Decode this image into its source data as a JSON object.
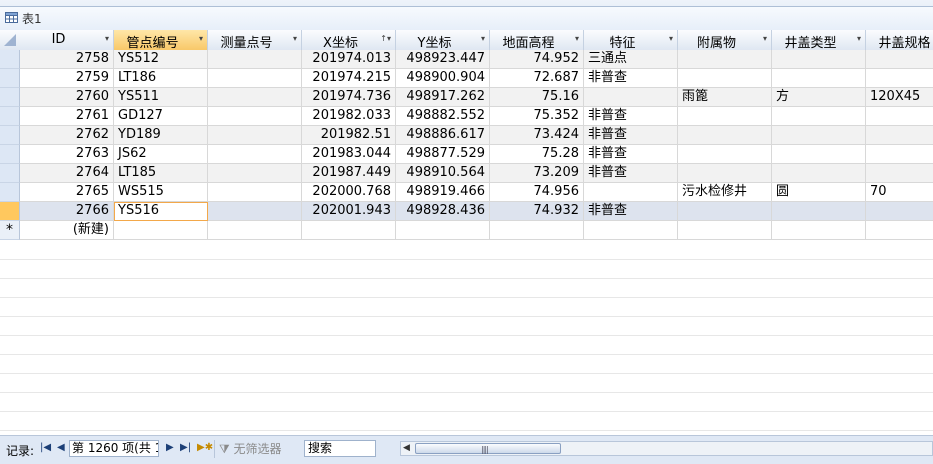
{
  "tab": {
    "label": "表1"
  },
  "columns": [
    {
      "label": "ID",
      "sorted": false,
      "icon": "dropdown-arrow"
    },
    {
      "label": "管点编号",
      "sorted": false,
      "icon": "dropdown-arrow"
    },
    {
      "label": "测量点号",
      "sorted": false,
      "icon": "dropdown-arrow"
    },
    {
      "label": "X坐标",
      "sorted": true,
      "icon": "sort-dropdown"
    },
    {
      "label": "Y坐标",
      "sorted": false,
      "icon": "dropdown-arrow"
    },
    {
      "label": "地面高程",
      "sorted": false,
      "icon": "dropdown-arrow"
    },
    {
      "label": "特征",
      "sorted": false,
      "icon": "dropdown-arrow"
    },
    {
      "label": "附属物",
      "sorted": false,
      "icon": "dropdown-arrow"
    },
    {
      "label": "井盖类型",
      "sorted": false,
      "icon": "dropdown-arrow"
    },
    {
      "label": "井盖规格",
      "sorted": false,
      "icon": "dropdown-arrow"
    }
  ],
  "rows": [
    [
      "2758",
      "YS512",
      "",
      "201974.013",
      "498923.447",
      "74.952",
      "三通点",
      "",
      "",
      ""
    ],
    [
      "2759",
      "LT186",
      "",
      "201974.215",
      "498900.904",
      "72.687",
      "非普查",
      "",
      "",
      ""
    ],
    [
      "2760",
      "YS511",
      "",
      "201974.736",
      "498917.262",
      "75.16",
      "",
      "雨篦",
      "方",
      "120X45"
    ],
    [
      "2761",
      "GD127",
      "",
      "201982.033",
      "498882.552",
      "75.352",
      "非普查",
      "",
      "",
      ""
    ],
    [
      "2762",
      "YD189",
      "",
      "201982.51",
      "498886.617",
      "73.424",
      "非普查",
      "",
      "",
      ""
    ],
    [
      "2763",
      "JS62",
      "",
      "201983.044",
      "498877.529",
      "75.28",
      "非普查",
      "",
      "",
      ""
    ],
    [
      "2764",
      "LT185",
      "",
      "201987.449",
      "498910.564",
      "73.209",
      "非普查",
      "",
      "",
      ""
    ],
    [
      "2765",
      "WS515",
      "",
      "202000.768",
      "498919.466",
      "74.956",
      "",
      "污水检修井",
      "圆",
      "70"
    ],
    [
      "2766",
      "YS516",
      "",
      "202001.943",
      "498928.436",
      "74.932",
      "非普查",
      "",
      "",
      ""
    ]
  ],
  "new_row": {
    "marker": "*",
    "label": "(新建)"
  },
  "status": {
    "record_label": "记录:",
    "record_position": "第 1260 项(共 1",
    "filter_label": "无筛选器",
    "search_label": "搜索"
  }
}
